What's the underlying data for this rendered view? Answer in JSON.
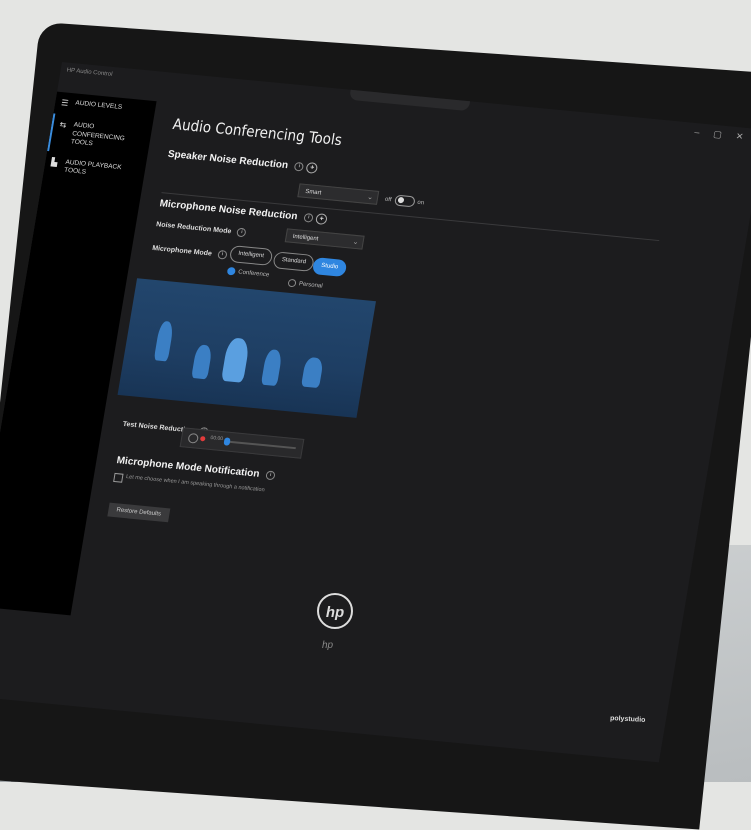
{
  "window": {
    "app_name": "HP Audio Control",
    "controls": [
      "–",
      "▢",
      "✕"
    ]
  },
  "sidebar": {
    "items": [
      {
        "label": "AUDIO LEVELS",
        "icon": "sliders-icon",
        "glyph": "☰"
      },
      {
        "label": "AUDIO CONFERENCING TOOLS",
        "icon": "conference-icon",
        "glyph": "⇆"
      },
      {
        "label": "AUDIO PLAYBACK TOOLS",
        "icon": "playback-icon",
        "glyph": "▙"
      }
    ]
  },
  "main": {
    "title": "Audio Conferencing Tools",
    "speaker": {
      "heading": "Speaker Noise Reduction",
      "select_value": "Smart",
      "toggle_off": "off",
      "toggle_on": "on"
    },
    "mic": {
      "heading": "Microphone Noise Reduction",
      "mode_label": "Noise Reduction Mode",
      "mode_value": "Intelligent",
      "mic_mode_label": "Microphone Mode",
      "buttons": [
        "Intelligent",
        "Standard",
        "Studio"
      ],
      "active_button": "Studio",
      "radio_options": [
        "Conference",
        "Personal"
      ],
      "test_label": "Test Noise Reduction",
      "timer": "00:00"
    },
    "notification": {
      "heading": "Microphone Mode Notification",
      "checkbox_text": "Let me choose when I am speaking through a notification",
      "restore_label": "Restore Defaults"
    }
  },
  "device": {
    "logo": "hp",
    "brand": "polystudio"
  }
}
